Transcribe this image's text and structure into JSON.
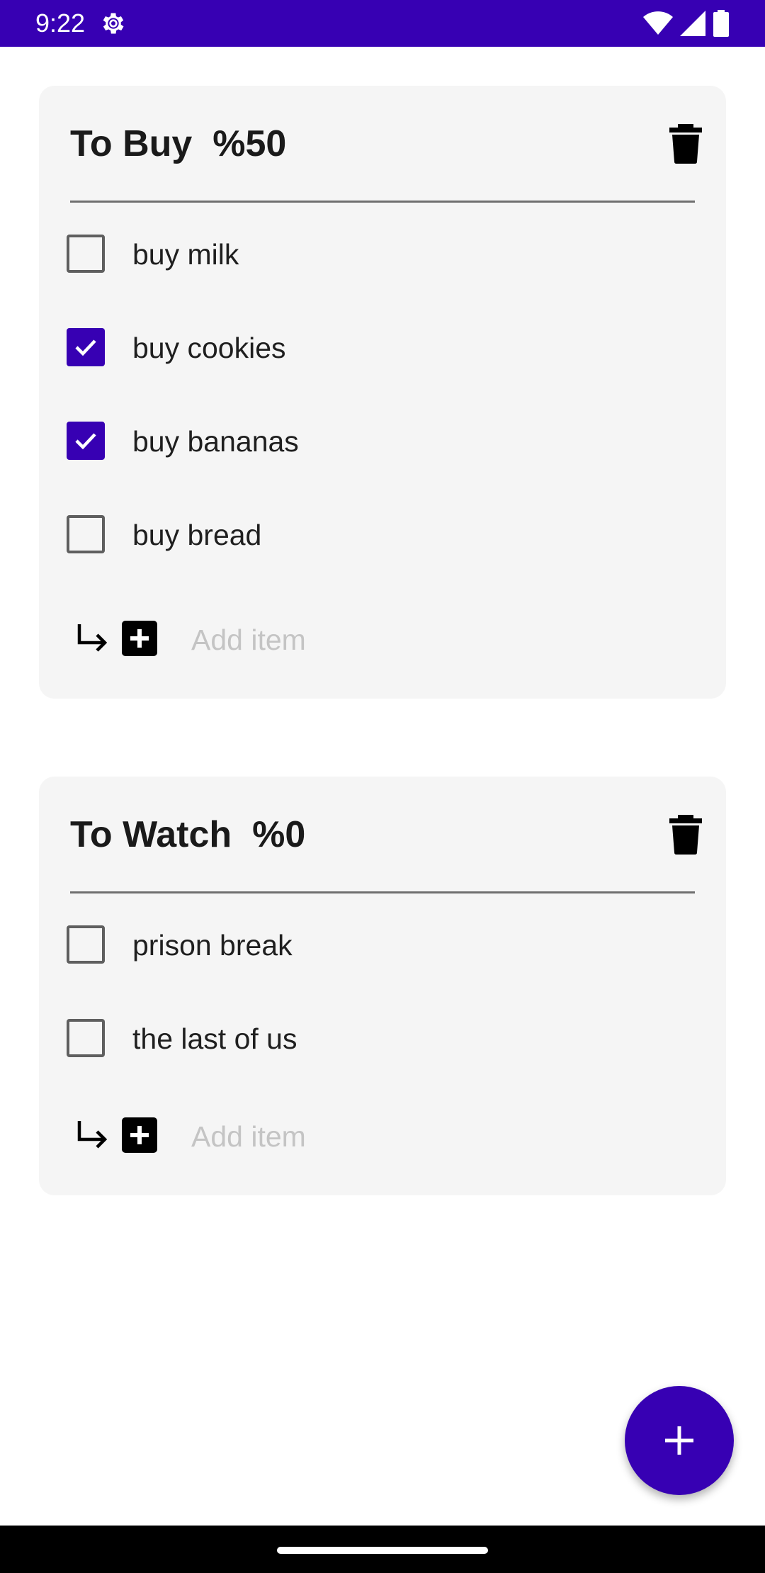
{
  "status_bar": {
    "time": "9:22",
    "icons": [
      "settings-gear-icon",
      "wifi-icon",
      "signal-icon",
      "battery-icon"
    ],
    "background": "#3700b3"
  },
  "lists": [
    {
      "title": "To Buy  %50",
      "items": [
        {
          "label": "buy milk",
          "checked": false
        },
        {
          "label": "buy cookies",
          "checked": true
        },
        {
          "label": "buy bananas",
          "checked": true
        },
        {
          "label": "buy bread",
          "checked": false
        }
      ],
      "add_placeholder": "Add item"
    },
    {
      "title": "To Watch  %0",
      "items": [
        {
          "label": "prison break",
          "checked": false
        },
        {
          "label": "the last of us",
          "checked": false
        }
      ],
      "add_placeholder": "Add item"
    }
  ],
  "fab": {
    "icon": "plus-icon",
    "color": "#3700b3"
  },
  "colors": {
    "accent": "#3700b3",
    "card_background": "#f5f5f5"
  }
}
